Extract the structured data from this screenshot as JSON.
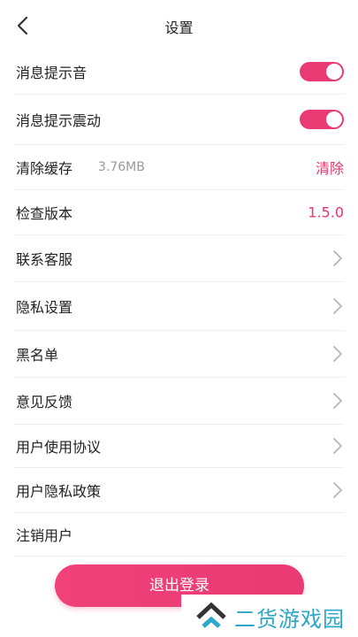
{
  "header": {
    "title": "设置",
    "back_icon": "chevron-left-icon"
  },
  "settings": {
    "message_sound": {
      "label": "消息提示音",
      "enabled": true
    },
    "message_vibrate": {
      "label": "消息提示震动",
      "enabled": true
    },
    "clear_cache": {
      "label": "清除缓存",
      "size": "3.76MB",
      "action": "清除"
    },
    "check_version": {
      "label": "检查版本",
      "version": "1.5.0"
    },
    "contact_service": {
      "label": "联系客服"
    },
    "privacy_settings": {
      "label": "隐私设置"
    },
    "blacklist": {
      "label": "黑名单"
    },
    "feedback": {
      "label": "意见反馈"
    },
    "user_agreement": {
      "label": "用户使用协议"
    },
    "privacy_policy": {
      "label": "用户隐私政策"
    },
    "delete_account": {
      "label": "注销用户"
    }
  },
  "footer": {
    "logout_label": "退出登录"
  },
  "watermark": {
    "text": "二货游戏园"
  },
  "colors": {
    "accent": "#ea3a74",
    "toggle_on": "#ea3a74",
    "divider": "#eeeeee",
    "muted": "#999999",
    "chevron": "#b5b5b5",
    "watermark": "#2aa7c9"
  }
}
